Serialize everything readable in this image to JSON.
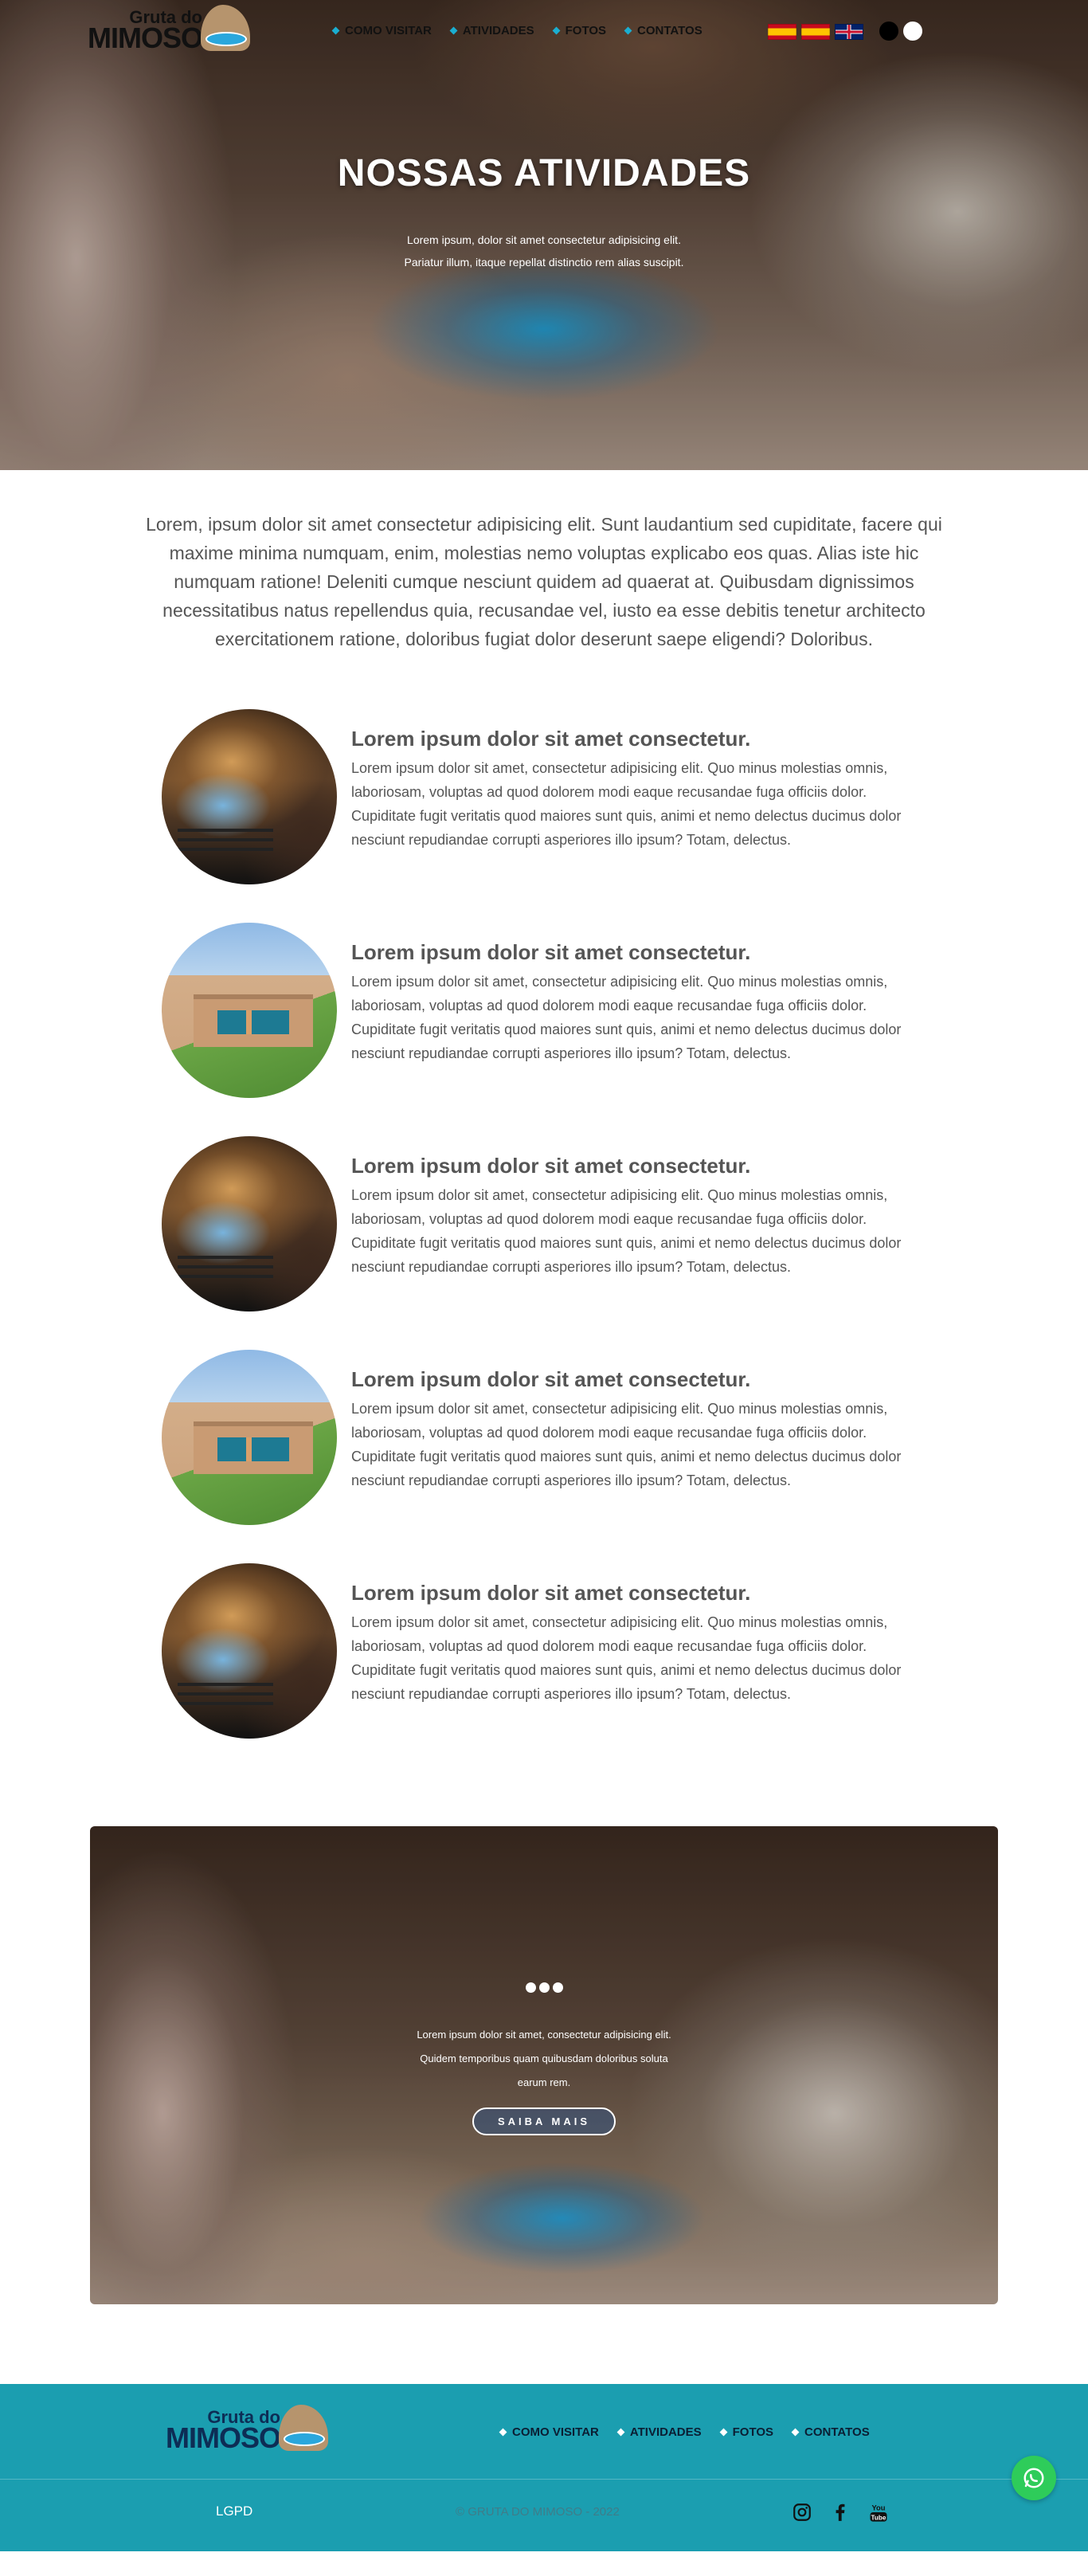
{
  "brand": {
    "name_top": "Gruta do",
    "name_bottom": "MIMOSO"
  },
  "nav": {
    "items": [
      {
        "label": "COMO VISITAR"
      },
      {
        "label": "ATIVIDADES"
      },
      {
        "label": "FOTOS"
      },
      {
        "label": "CONTATOS"
      }
    ],
    "languages": [
      "spanish-flag",
      "spanish-flag",
      "uk-flag"
    ],
    "theme_toggle": [
      "dark",
      "light"
    ]
  },
  "hero": {
    "title": "NOSSAS ATIVIDADES",
    "subtitle": "Lorem ipsum, dolor sit amet consectetur adipisicing elit. Pariatur illum, itaque repellat distinctio rem alias suscipit."
  },
  "intro": {
    "text": "Lorem, ipsum dolor sit amet consectetur adipisicing elit. Sunt laudantium sed cupiditate, facere qui maxime minima numquam, enim, molestias nemo voluptas explicabo eos quas. Alias iste hic numquam ratione! Deleniti cumque nesciunt quidem ad quaerat at. Quibusdam dignissimos necessitatibus natus repellendus quia, recusandae vel, iusto ea esse debitis tenetur architecto exercitationem ratione, doloribus fugiat dolor deserunt saepe eligendi? Doloribus."
  },
  "activities": [
    {
      "title": "Lorem ipsum dolor sit amet consectetur.",
      "body": "Lorem ipsum dolor sit amet, consectetur adipisicing elit. Quo minus molestias omnis, laboriosam, voluptas ad quod dolorem modi eaque recusandae fuga officiis dolor. Cupiditate fugit veritatis quod maiores sunt quis, animi et nemo delectus ducimus dolor nesciunt repudiandae corrupti asperiores illo ipsum? Totam, delectus.",
      "image": "cave"
    },
    {
      "title": "Lorem ipsum dolor sit amet consectetur.",
      "body": "Lorem ipsum dolor sit amet, consectetur adipisicing elit. Quo minus molestias omnis, laboriosam, voluptas ad quod dolorem modi eaque recusandae fuga officiis dolor. Cupiditate fugit veritatis quod maiores sunt quis, animi et nemo delectus ducimus dolor nesciunt repudiandae corrupti asperiores illo ipsum? Totam, delectus.",
      "image": "building"
    },
    {
      "title": "Lorem ipsum dolor sit amet consectetur.",
      "body": "Lorem ipsum dolor sit amet, consectetur adipisicing elit. Quo minus molestias omnis, laboriosam, voluptas ad quod dolorem modi eaque recusandae fuga officiis dolor. Cupiditate fugit veritatis quod maiores sunt quis, animi et nemo delectus ducimus dolor nesciunt repudiandae corrupti asperiores illo ipsum? Totam, delectus.",
      "image": "cave"
    },
    {
      "title": "Lorem ipsum dolor sit amet consectetur.",
      "body": "Lorem ipsum dolor sit amet, consectetur adipisicing elit. Quo minus molestias omnis, laboriosam, voluptas ad quod dolorem modi eaque recusandae fuga officiis dolor. Cupiditate fugit veritatis quod maiores sunt quis, animi et nemo delectus ducimus dolor nesciunt repudiandae corrupti asperiores illo ipsum? Totam, delectus.",
      "image": "building"
    },
    {
      "title": "Lorem ipsum dolor sit amet consectetur.",
      "body": "Lorem ipsum dolor sit amet, consectetur adipisicing elit. Quo minus molestias omnis, laboriosam, voluptas ad quod dolorem modi eaque recusandae fuga officiis dolor. Cupiditate fugit veritatis quod maiores sunt quis, animi et nemo delectus ducimus dolor nesciunt repudiandae corrupti asperiores illo ipsum? Totam, delectus.",
      "image": "cave"
    }
  ],
  "promo": {
    "text": "Lorem ipsum dolor sit amet, consectetur adipisicing elit. Quidem temporibus quam quibusdam doloribus soluta earum rem.",
    "button": "SAIBA MAIS",
    "slide_count": 3
  },
  "footer": {
    "menu": [
      {
        "label": "COMO VISITAR"
      },
      {
        "label": "ATIVIDADES"
      },
      {
        "label": "FOTOS"
      },
      {
        "label": "CONTATOS"
      }
    ],
    "lgpd": "LGPD",
    "copyright": "© GRUTA DO MIMOSO - 2022",
    "socials": [
      "instagram-icon",
      "facebook-icon",
      "youtube-icon"
    ],
    "youtube_label": "You Tube"
  },
  "colors": {
    "accent": "#1aaed1",
    "footer_bg": "#1b9eb0",
    "whatsapp": "#2ecc5a",
    "text": "#555555"
  }
}
